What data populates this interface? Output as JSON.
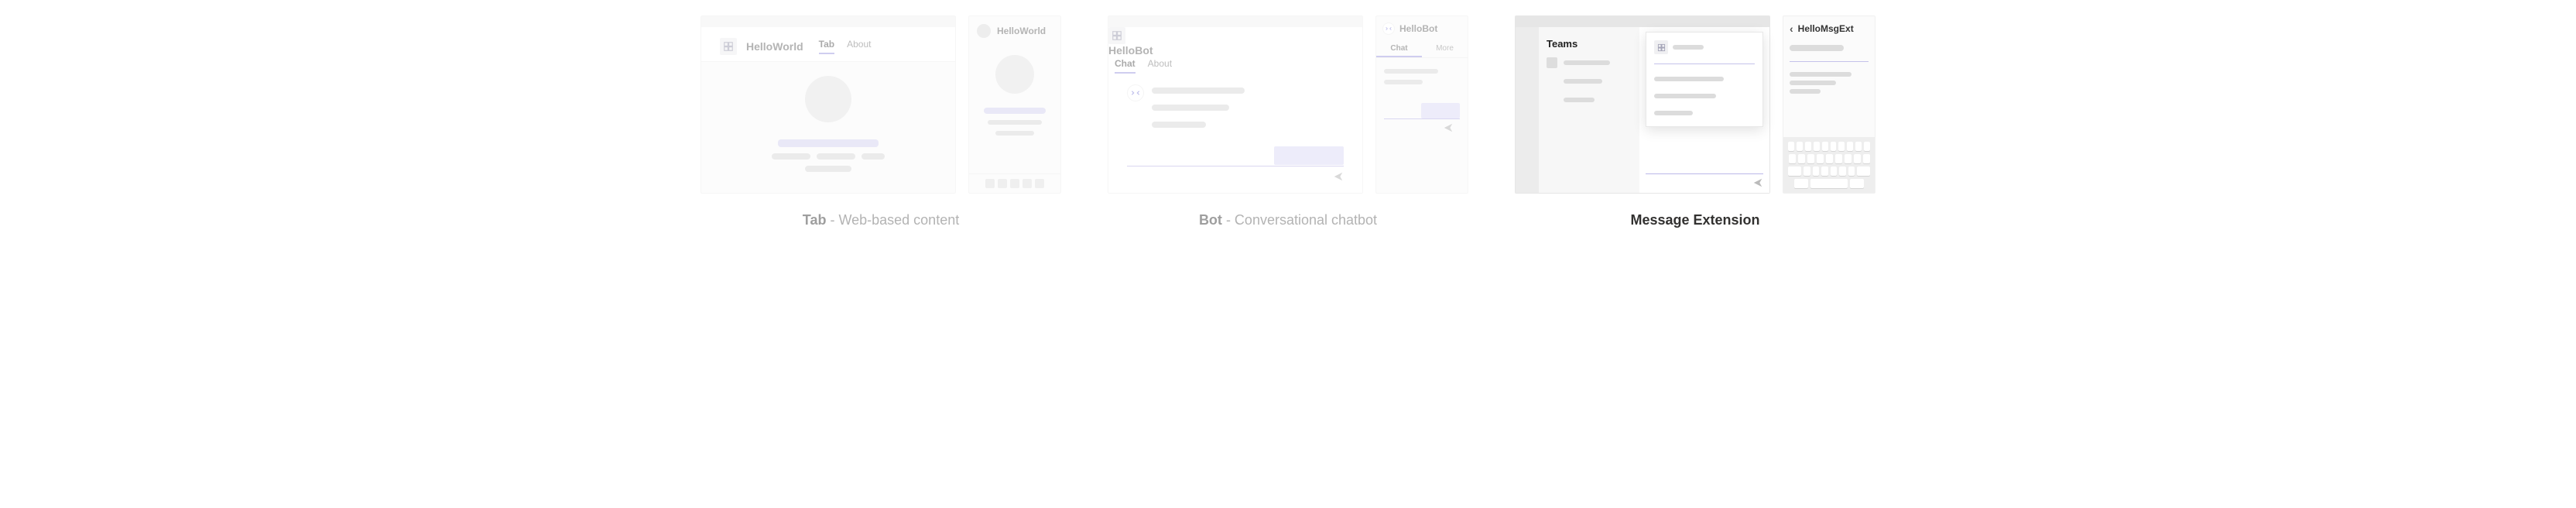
{
  "sections": {
    "tab": {
      "caption_bold": "Tab",
      "caption_rest": " - Web-based content",
      "desktop": {
        "app_name": "HelloWorld",
        "tabs": [
          "Tab",
          "About"
        ]
      },
      "mobile": {
        "title": "HelloWorld"
      }
    },
    "bot": {
      "caption_bold": "Bot",
      "caption_rest": " - Conversational chatbot",
      "desktop": {
        "app_name": "HelloBot",
        "tabs": [
          "Chat",
          "About"
        ]
      },
      "mobile": {
        "title": "HelloBot",
        "tabs": [
          "Chat",
          "More"
        ]
      }
    },
    "me": {
      "caption_bold": "Message Extension",
      "caption_rest": "",
      "desktop": {
        "sidebar_title": "Teams"
      },
      "mobile": {
        "title": "HelloMsgExt"
      }
    }
  }
}
